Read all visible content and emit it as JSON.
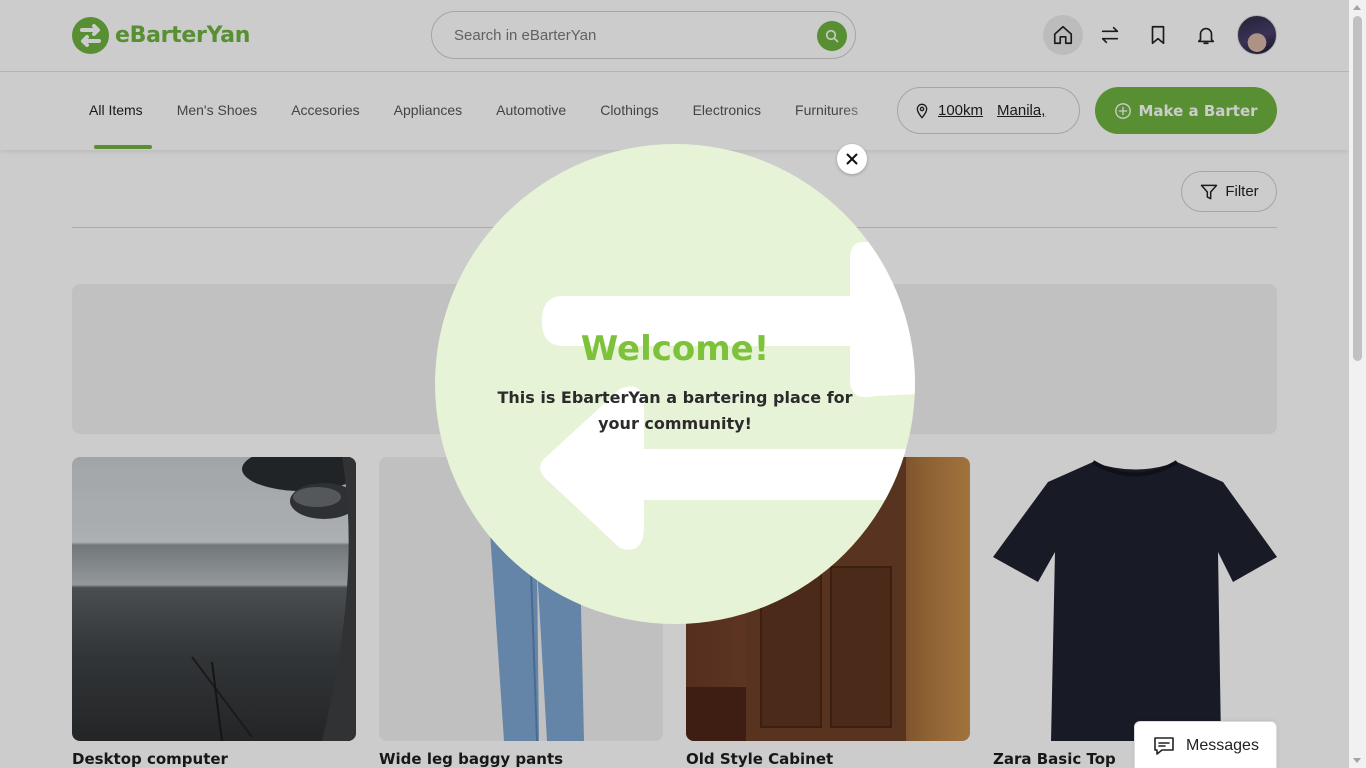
{
  "app": {
    "brand_name": "eBarterYan",
    "brand_color": "#6db33f"
  },
  "header": {
    "search_placeholder": "Search in eBarterYan",
    "icons": [
      "home-icon",
      "swap-icon",
      "bookmark-icon",
      "bell-icon"
    ],
    "active_icon": "home-icon"
  },
  "categories": {
    "items": [
      "All Items",
      "Men's Shoes",
      "Accesories",
      "Appliances",
      "Automotive",
      "Clothings",
      "Electronics",
      "Furnitures"
    ],
    "active": "All Items"
  },
  "location": {
    "radius": "100km",
    "place": "Manila,"
  },
  "actions": {
    "make_barter_label": "Make a Barter",
    "filter_label": "Filter",
    "messages_label": "Messages"
  },
  "listings": [
    {
      "title": "Desktop computer"
    },
    {
      "title": "Wide leg baggy pants"
    },
    {
      "title": "Old Style Cabinet"
    },
    {
      "title": "Zara Basic Top"
    }
  ],
  "welcome_modal": {
    "heading": "Welcome!",
    "message": "This is EbarterYan a bartering place for your community!"
  }
}
